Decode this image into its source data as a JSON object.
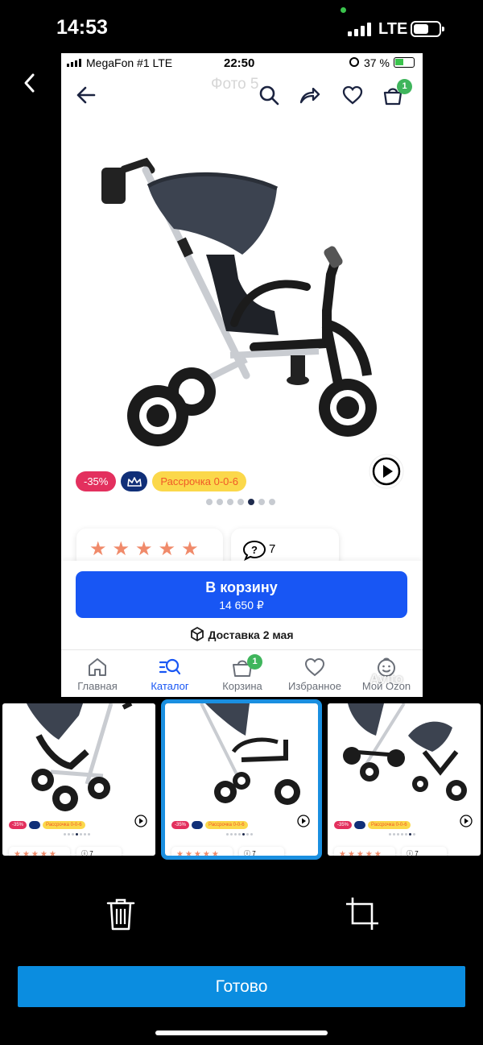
{
  "os_status": {
    "time": "14:53",
    "network": "LTE"
  },
  "inner_status": {
    "carrier": "MegaFon #1  LTE",
    "time": "22:50",
    "battery": "37 %"
  },
  "header": {
    "photo_title": "Фото 5",
    "cart_count": "1"
  },
  "product": {
    "discount_badge": "-35%",
    "installment_badge": "Рассрочка 0-0-6",
    "photo_dots": 7,
    "active_dot": 5,
    "rating_stars": 5,
    "questions_count": "7"
  },
  "cart_button": {
    "label": "В корзину",
    "price": "14 650 ₽"
  },
  "delivery": {
    "label": "Доставка 2 мая"
  },
  "tabs": [
    {
      "label": "Главная",
      "icon": "home-icon"
    },
    {
      "label": "Каталог",
      "icon": "catalog-search-icon",
      "active": true
    },
    {
      "label": "Корзина",
      "icon": "basket-icon",
      "badge": "1"
    },
    {
      "label": "Избранное",
      "icon": "heart-icon"
    },
    {
      "label": "Мой Ozon",
      "icon": "smiley-icon"
    }
  ],
  "watermark": "Avito",
  "thumbnails": [
    {
      "discount": "-35%",
      "installment": "Рассрочка 0-0-6",
      "questions": "7",
      "selected": false
    },
    {
      "discount": "-35%",
      "installment": "Рассрочка 0-0-6",
      "questions": "7",
      "selected": true
    },
    {
      "discount": "-35%",
      "installment": "Рассрочка 0-0-6",
      "questions": "7",
      "selected": false
    }
  ],
  "actions": {
    "delete_icon": "trash-icon",
    "crop_icon": "crop-icon"
  },
  "done_button": {
    "label": "Готово"
  },
  "colors": {
    "accent_blue": "#1856f4",
    "done_blue": "#0b8de0",
    "discount_red": "#e3305e",
    "badge_green": "#3fb55c",
    "installment_yellow": "#fbd84b"
  }
}
